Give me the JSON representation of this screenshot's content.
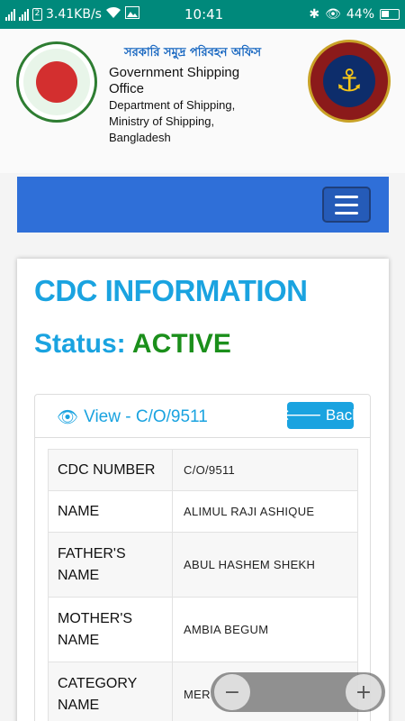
{
  "statusbar": {
    "net_speed": "3.41KB/s",
    "sim_label": "2",
    "time": "10:41",
    "battery": "44%",
    "icons": [
      "signal-icon",
      "sim-icon",
      "wifi-icon",
      "image-icon",
      "bluetooth-icon",
      "eye-icon",
      "battery-icon"
    ]
  },
  "header": {
    "bengali_title": "সরকারি সমুদ্র পরিবহন অফিস",
    "org_name": "Government Shipping Office",
    "dept_line1": "Department of Shipping,",
    "dept_line2": "Ministry of Shipping,",
    "dept_line3": "Bangladesh"
  },
  "navbar": {
    "menu_icon": "hamburger-icon"
  },
  "page": {
    "title": "CDC INFORMATION",
    "status_label": "Status:",
    "status_value": "ACTIVE"
  },
  "panel": {
    "view_label": "View - C/O/9511",
    "back_label": "Back",
    "rows": [
      {
        "key": "CDC NUMBER",
        "value": "C/O/9511"
      },
      {
        "key": "NAME",
        "value": "ALIMUL RAJI ASHIQUE"
      },
      {
        "key": "FATHER'S NAME",
        "value": "ABUL HASHEM SHEKH"
      },
      {
        "key": "MOTHER'S NAME",
        "value": "AMBIA BEGUM"
      },
      {
        "key": "CATEGORY NAME",
        "value": "MER"
      }
    ]
  },
  "zoom": {
    "minus": "−",
    "plus": "+"
  },
  "colors": {
    "statusbar": "#00897b",
    "navbar": "#2f6fd8",
    "accent": "#1aa3e0",
    "active": "#1b8f1b"
  }
}
